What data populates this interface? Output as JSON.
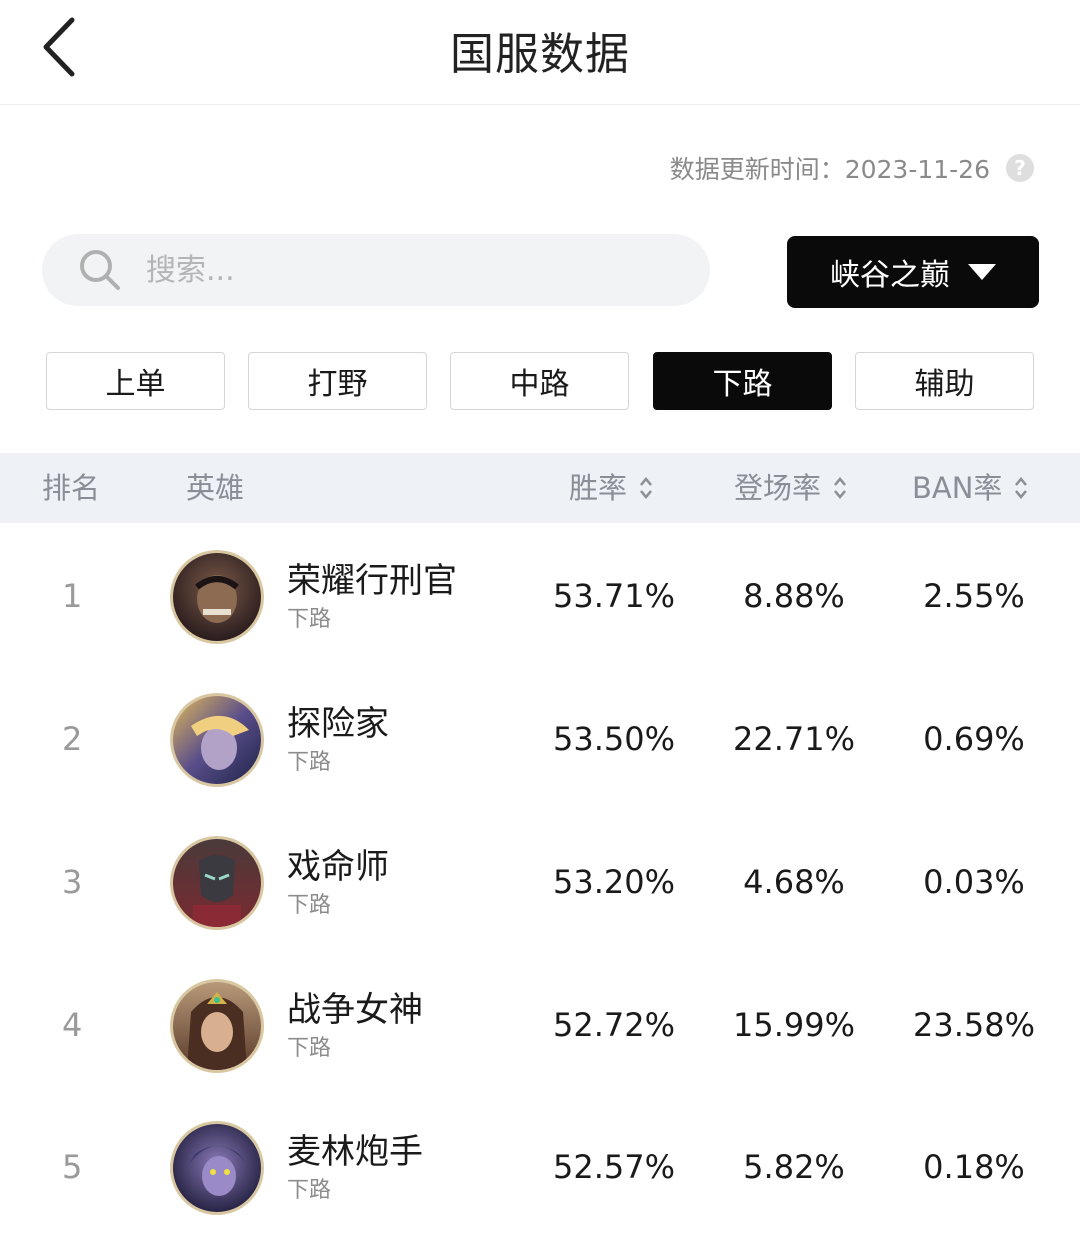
{
  "header": {
    "title": "国服数据"
  },
  "update": {
    "label": "数据更新时间：2023-11-26"
  },
  "search": {
    "placeholder": "搜索..."
  },
  "mode_select": {
    "value": "峡谷之巅"
  },
  "lanes": [
    {
      "label": "上单"
    },
    {
      "label": "打野"
    },
    {
      "label": "中路"
    },
    {
      "label": "下路",
      "active": true
    },
    {
      "label": "辅助"
    }
  ],
  "table": {
    "headers": {
      "rank": "排名",
      "hero": "英雄",
      "win": "胜率",
      "pick": "登场率",
      "ban": "BAN率"
    },
    "rows": [
      {
        "rank": "1",
        "name": "荣耀行刑官",
        "lane": "下路",
        "win": "53.71%",
        "pick": "8.88%",
        "ban": "2.55%"
      },
      {
        "rank": "2",
        "name": "探险家",
        "lane": "下路",
        "win": "53.50%",
        "pick": "22.71%",
        "ban": "0.69%"
      },
      {
        "rank": "3",
        "name": "戏命师",
        "lane": "下路",
        "win": "53.20%",
        "pick": "4.68%",
        "ban": "0.03%"
      },
      {
        "rank": "4",
        "name": "战争女神",
        "lane": "下路",
        "win": "52.72%",
        "pick": "15.99%",
        "ban": "23.58%"
      },
      {
        "rank": "5",
        "name": "麦林炮手",
        "lane": "下路",
        "win": "52.57%",
        "pick": "5.82%",
        "ban": "0.18%"
      }
    ]
  },
  "colors": {
    "accent": "#0a0a0a",
    "header_bg": "#eef1f5",
    "muted": "#8a8e96"
  }
}
